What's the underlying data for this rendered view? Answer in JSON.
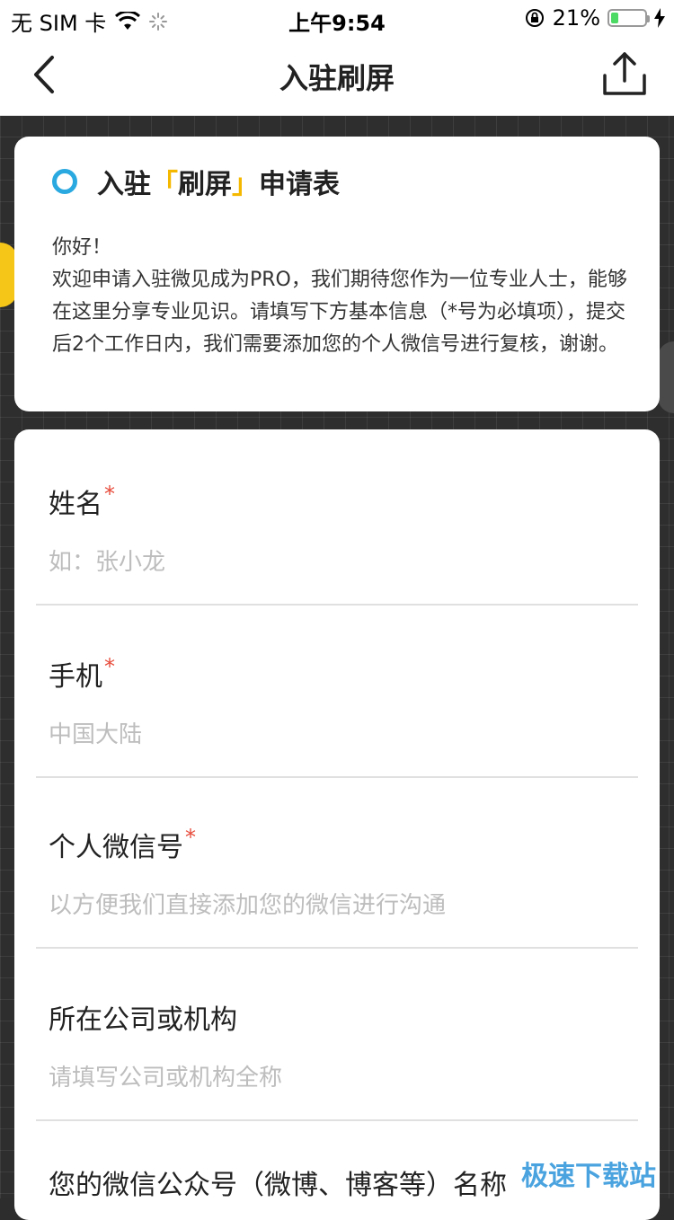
{
  "status_bar": {
    "carrier": "无 SIM 卡",
    "time": "上午9:54",
    "battery_percent": "21%",
    "battery_level": 0.21
  },
  "nav": {
    "title": "入驻刷屏"
  },
  "intro_card": {
    "heading_prefix": "入驻",
    "heading_bracket_open": "「",
    "heading_name": "刷屏",
    "heading_bracket_close": "」",
    "heading_suffix": "申请表",
    "text": "你好！\n欢迎申请入驻微见成为PRO，我们期待您作为一位专业人士，能够在这里分享专业见识。请填写下方基本信息（*号为必填项），提交后2个工作日内，我们需要添加您的个人微信号进行复核，谢谢。"
  },
  "form": {
    "required_mark": "*",
    "fields": [
      {
        "label": "姓名",
        "required": true,
        "placeholder": "如：张小龙"
      },
      {
        "label": "手机",
        "required": true,
        "placeholder": "中国大陆"
      },
      {
        "label": "个人微信号",
        "required": true,
        "placeholder": "以方便我们直接添加您的微信进行沟通"
      },
      {
        "label": "所在公司或机构",
        "required": false,
        "placeholder": "请填写公司或机构全称"
      },
      {
        "label": "您的微信公众号（微博、博客等）名称",
        "required": false,
        "placeholder": ""
      }
    ]
  },
  "watermark": "极速下载站",
  "colors": {
    "accent_yellow": "#f5b800",
    "ring_blue": "#2aa9e0",
    "required_red": "#e74c3c",
    "battery_green": "#4cd964"
  }
}
